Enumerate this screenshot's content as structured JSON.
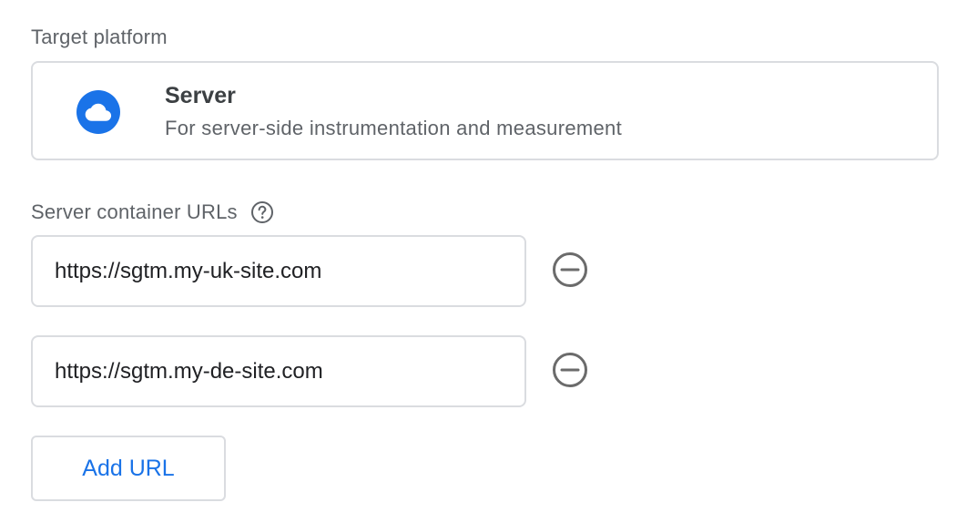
{
  "target_platform": {
    "label": "Target platform",
    "selected": {
      "icon": "cloud-icon",
      "title": "Server",
      "description": "For server-side instrumentation and measurement"
    }
  },
  "server_urls": {
    "label": "Server container URLs",
    "help_icon": "help-circle-icon",
    "urls": [
      {
        "value": "https://sgtm.my-uk-site.com",
        "remove_icon": "remove-circle-icon"
      },
      {
        "value": "https://sgtm.my-de-site.com",
        "remove_icon": "remove-circle-icon"
      }
    ],
    "add_button_label": "Add URL"
  },
  "colors": {
    "accent": "#1a73e8",
    "border": "#dadce0",
    "muted_text": "#5f6368",
    "icon_gray": "#6b6b6b"
  }
}
